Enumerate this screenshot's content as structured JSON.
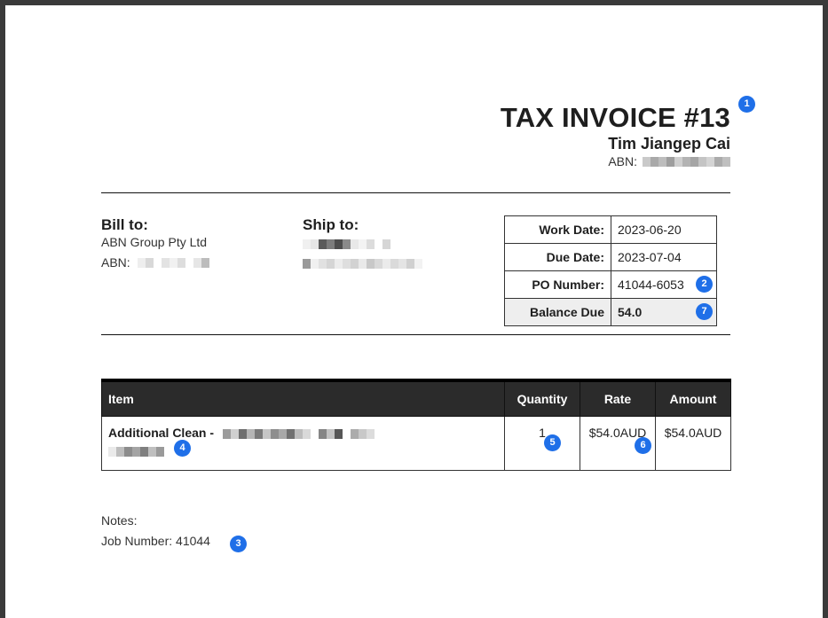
{
  "invoice": {
    "title": "TAX INVOICE #13",
    "issuer_name": "Tim Jiangер Cai",
    "issuer_abn_label": "ABN:"
  },
  "bill_to": {
    "heading": "Bill to:",
    "company": "ABN Group Pty Ltd",
    "abn_label": "ABN:"
  },
  "ship_to": {
    "heading": "Ship to:"
  },
  "details": {
    "work_date_label": "Work Date:",
    "work_date": "2023-06-20",
    "due_date_label": "Due Date:",
    "due_date": "2023-07-04",
    "po_label": "PO Number:",
    "po_number": "41044-6053",
    "balance_label": "Balance Due",
    "balance": "54.0"
  },
  "items": {
    "headers": {
      "item": "Item",
      "quantity": "Quantity",
      "rate": "Rate",
      "amount": "Amount"
    },
    "rows": [
      {
        "description": "Additional Clean -",
        "quantity": "1",
        "rate": "$54.0AUD",
        "amount": "$54.0AUD"
      }
    ]
  },
  "notes": {
    "label": "Notes:",
    "job_number": "Job Number: 41044"
  },
  "badges": [
    "1",
    "2",
    "3",
    "4",
    "5",
    "6",
    "7"
  ],
  "colors": {
    "badge": "#1f6fe8",
    "table_header_bg": "#2b2b2b",
    "balance_row_bg": "#eeeeee"
  }
}
